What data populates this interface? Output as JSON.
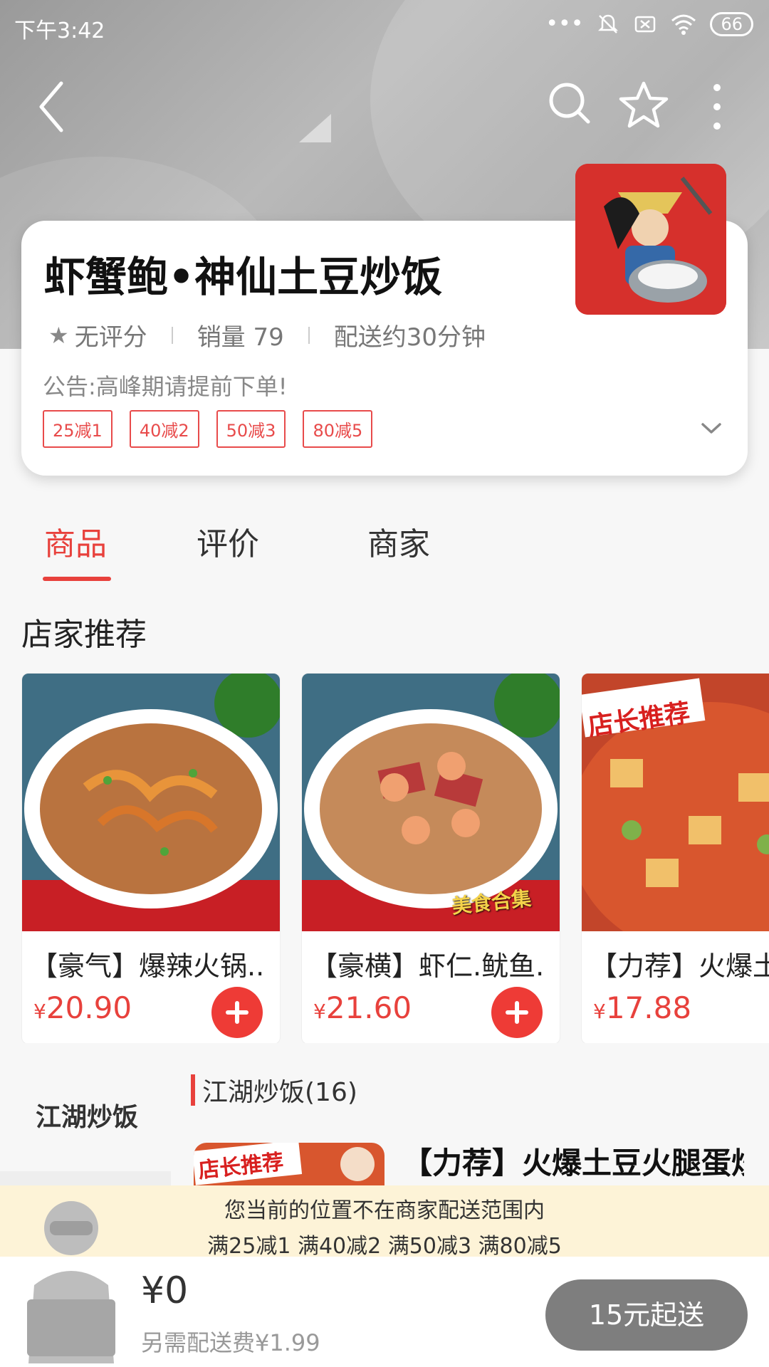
{
  "status_bar": {
    "time": "下午3:42",
    "battery": "66"
  },
  "shop": {
    "name": "虾蟹鲍•神仙土豆炒饭",
    "rating": "无评分",
    "sales": "销量 79",
    "delivery_time": "配送约30分钟",
    "notice": "公告:高峰期请提前下单!",
    "discounts": [
      "25减1",
      "40减2",
      "50减3",
      "80减5"
    ]
  },
  "tabs": [
    "商品",
    "评价",
    "商家"
  ],
  "recommend": {
    "title": "店家推荐",
    "items": [
      {
        "name": "【豪气】爆辣火锅...",
        "yen": "¥",
        "price": "20.90"
      },
      {
        "name": "【豪横】虾仁.鱿鱼...",
        "yen": "¥",
        "price": "21.60"
      },
      {
        "name": "【力荐】火爆土",
        "yen": "¥",
        "price": "17.88"
      }
    ],
    "image_labels": [
      "美食合集",
      "店长推荐"
    ]
  },
  "sidebar": {
    "items": [
      "江湖炒饭"
    ]
  },
  "category": {
    "title": "江湖炒饭(16)"
  },
  "list_item": {
    "name": "【力荐】火爆土豆火腿蛋炒饭",
    "thumb_label": "店长推荐"
  },
  "notice_bar": {
    "line1": "您当前的位置不在商家配送范围内",
    "line2": "满25减1  满40减2  满50减3  满80减5"
  },
  "cart": {
    "total": "¥0",
    "delivery_fee": "另需配送费¥1.99",
    "checkout": "15元起送"
  },
  "colors": {
    "accent": "#e8413c",
    "checkout_bg": "#7e7e7e",
    "notice_bg": "#fdf3d7"
  }
}
